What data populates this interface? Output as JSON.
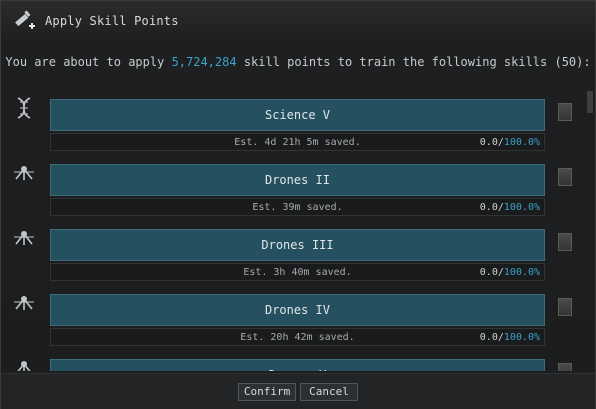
{
  "window": {
    "title": "Apply Skill Points",
    "icon": "skill-injector-icon"
  },
  "summary": {
    "prefix": "You are about to apply ",
    "points": "5,724,284",
    "suffix": " skill points to train the following skills (50):"
  },
  "skills": [
    {
      "name": "Science V",
      "saved": "Est. 4d 21h 5m saved.",
      "progress": "0.0",
      "target": "100.0%",
      "icon": "dna-icon"
    },
    {
      "name": "Drones II",
      "saved": "Est. 39m saved.",
      "progress": "0.0",
      "target": "100.0%",
      "icon": "drone-icon"
    },
    {
      "name": "Drones III",
      "saved": "Est. 3h 40m saved.",
      "progress": "0.0",
      "target": "100.0%",
      "icon": "drone-icon"
    },
    {
      "name": "Drones IV",
      "saved": "Est. 20h 42m saved.",
      "progress": "0.0",
      "target": "100.0%",
      "icon": "drone-icon"
    },
    {
      "name": "Drones V",
      "saved": "",
      "progress": "",
      "target": "",
      "icon": "drone-icon"
    }
  ],
  "buttons": {
    "confirm": "Confirm",
    "cancel": "Cancel"
  },
  "colors": {
    "accent": "#3aa3c7",
    "bar": "#24505f"
  }
}
